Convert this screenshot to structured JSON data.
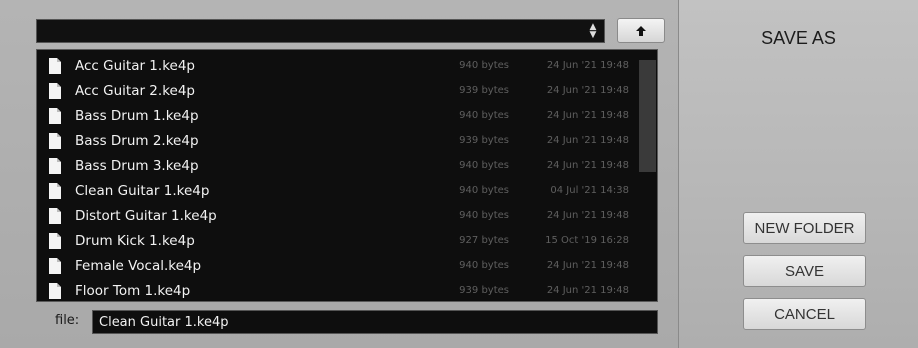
{
  "dialog": {
    "title": "SAVE AS"
  },
  "path_select": {
    "value": "",
    "arrows_icon": "up-down-arrows-icon"
  },
  "up_button": {
    "icon": "arrow-up-icon"
  },
  "files": [
    {
      "name": "Acc Guitar 1.ke4p",
      "size": "940 bytes",
      "date": "24 Jun '21 19:48"
    },
    {
      "name": "Acc Guitar 2.ke4p",
      "size": "939 bytes",
      "date": "24 Jun '21 19:48"
    },
    {
      "name": "Bass Drum 1.ke4p",
      "size": "940 bytes",
      "date": "24 Jun '21 19:48"
    },
    {
      "name": "Bass Drum 2.ke4p",
      "size": "939 bytes",
      "date": "24 Jun '21 19:48"
    },
    {
      "name": "Bass Drum 3.ke4p",
      "size": "940 bytes",
      "date": "24 Jun '21 19:48"
    },
    {
      "name": "Clean Guitar 1.ke4p",
      "size": "940 bytes",
      "date": "04 Jul '21 14:38"
    },
    {
      "name": "Distort Guitar 1.ke4p",
      "size": "940 bytes",
      "date": "24 Jun '21 19:48"
    },
    {
      "name": "Drum Kick 1.ke4p",
      "size": "927 bytes",
      "date": "15 Oct '19 16:28"
    },
    {
      "name": "Female Vocal.ke4p",
      "size": "940 bytes",
      "date": "24 Jun '21 19:48"
    },
    {
      "name": "Floor Tom 1.ke4p",
      "size": "939 bytes",
      "date": "24 Jun '21 19:48"
    }
  ],
  "file_field": {
    "label": "file:",
    "value": "Clean Guitar 1.ke4p"
  },
  "buttons": {
    "new_folder": "NEW FOLDER",
    "save": "SAVE",
    "cancel": "CANCEL"
  },
  "colors": {
    "list_bg": "#0e0e0e",
    "panel_bg": "#b0b0b0",
    "meta_text": "#5f5f5f"
  }
}
